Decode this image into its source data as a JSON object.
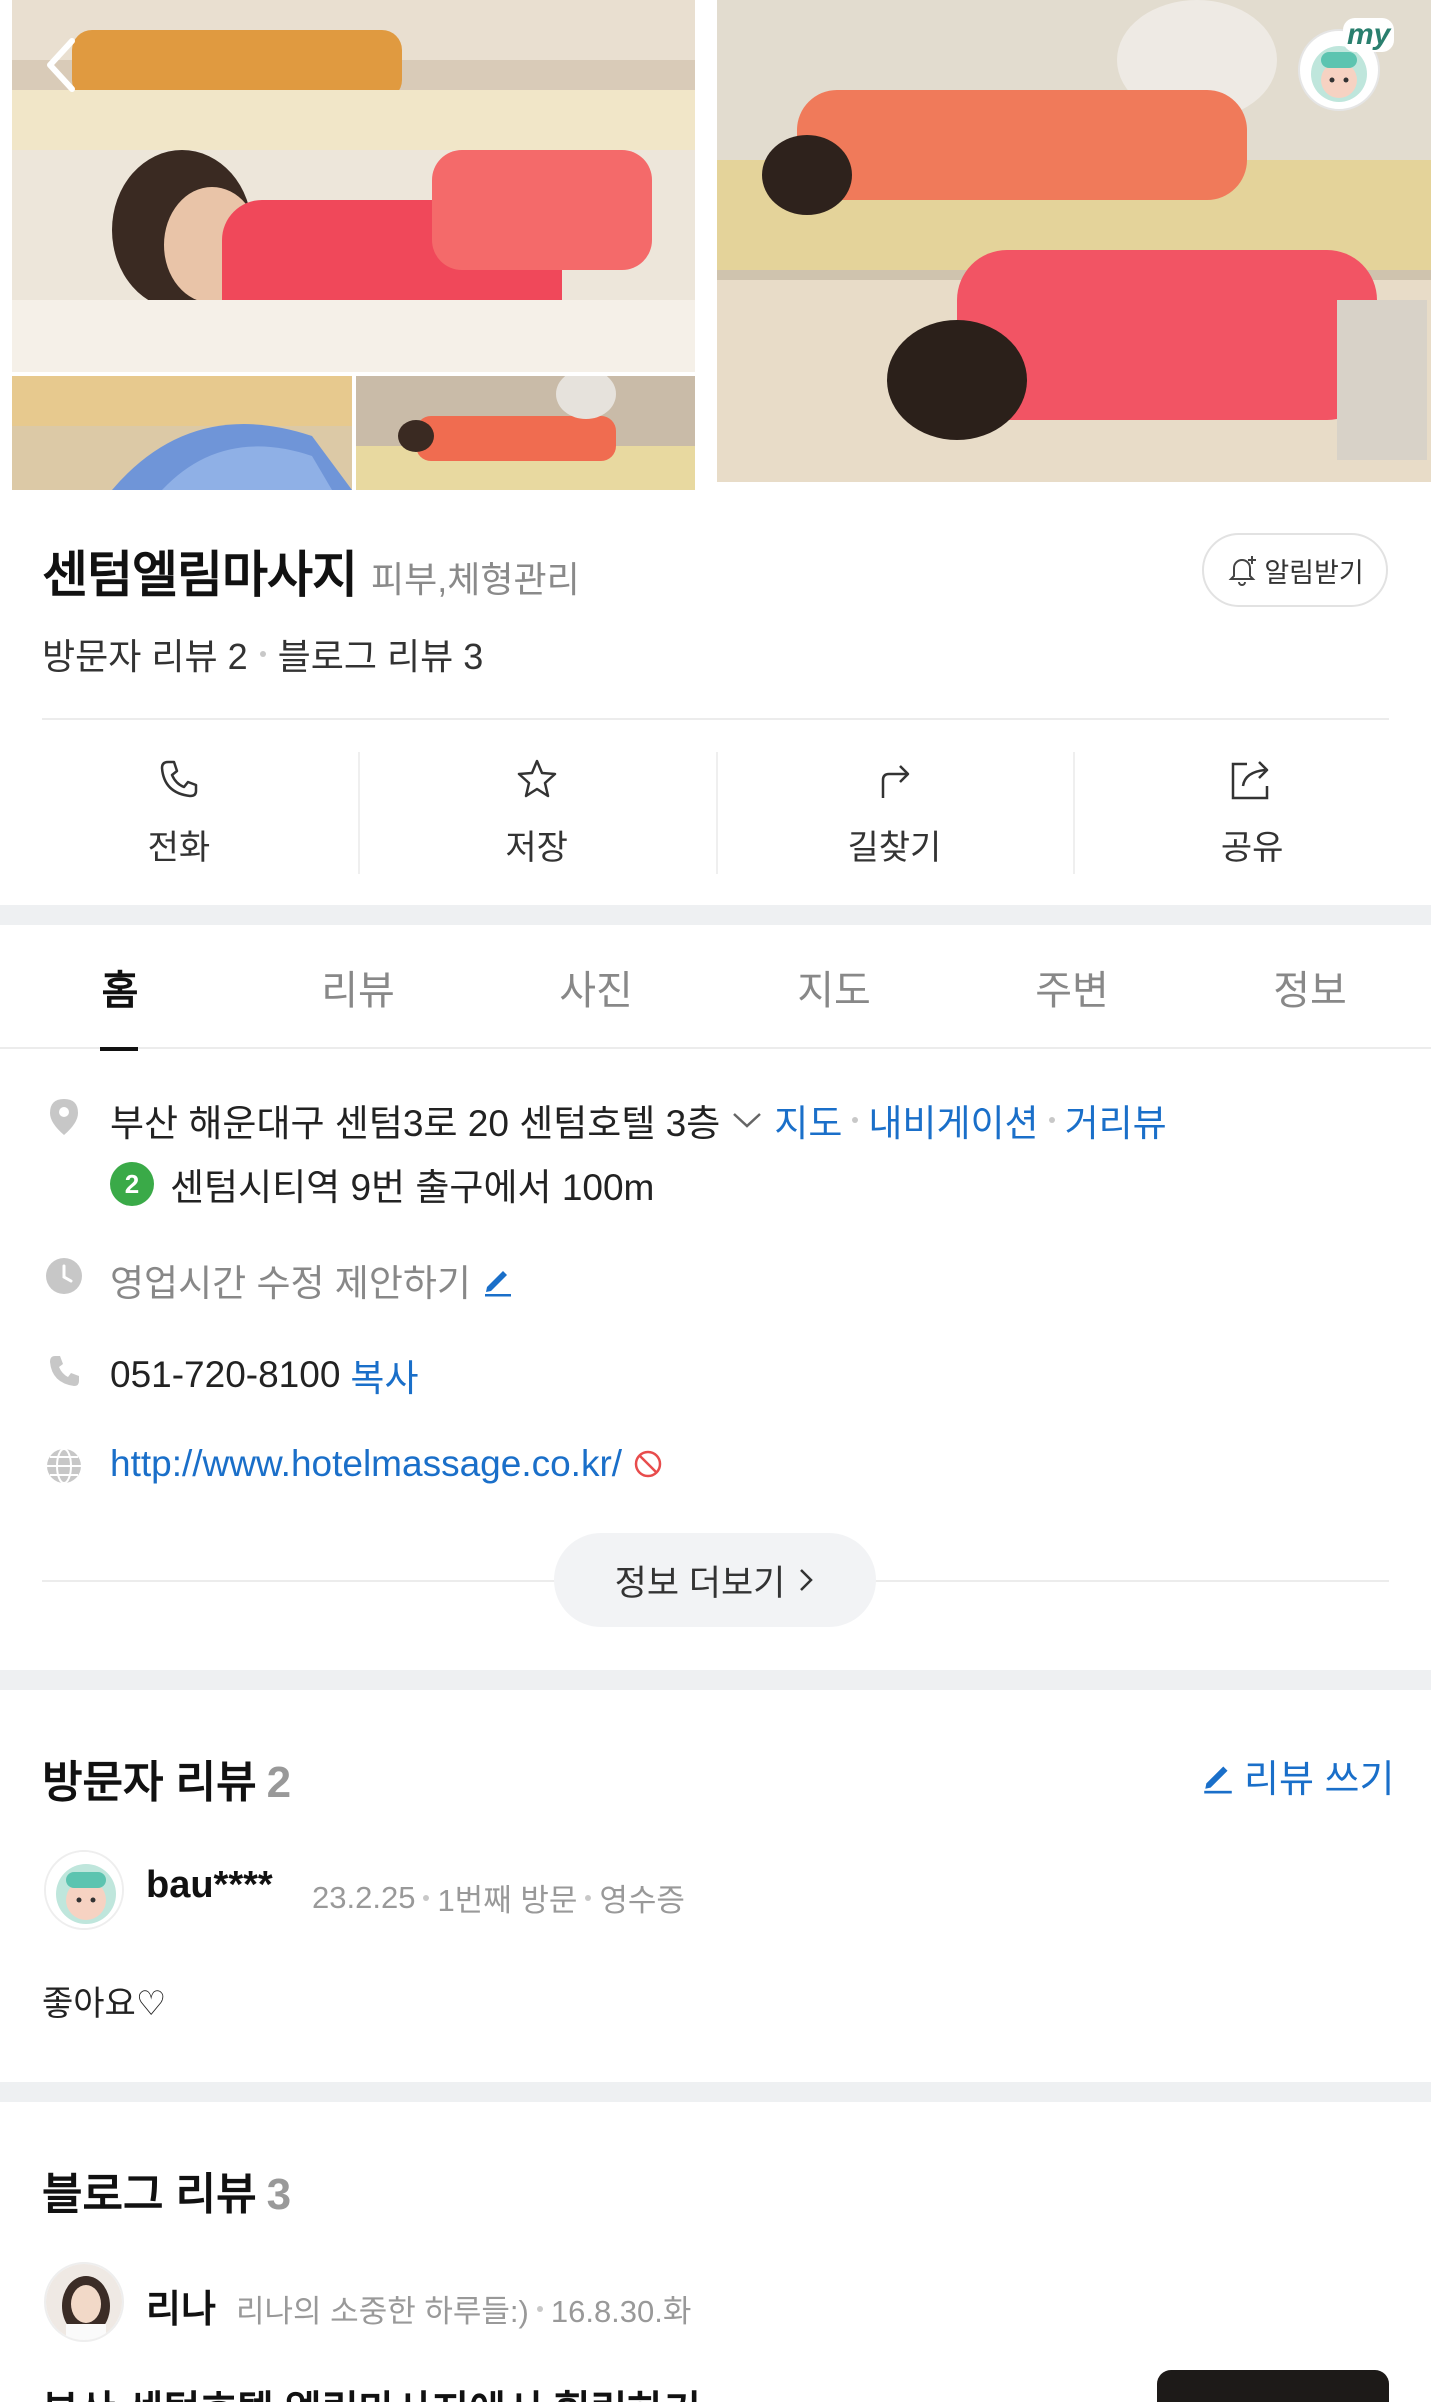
{
  "header": {
    "back_icon": "chevron-left-icon",
    "my_label": "my"
  },
  "place": {
    "name": "센텀엘림마사지",
    "category": "피부,체형관리",
    "alarm_label": "알림받기",
    "visitor_review_label": "방문자 리뷰 2",
    "blog_review_label": "블로그 리뷰 3"
  },
  "actions": [
    {
      "label": "전화",
      "icon": "phone-icon"
    },
    {
      "label": "저장",
      "icon": "star-icon"
    },
    {
      "label": "길찾기",
      "icon": "directions-icon"
    },
    {
      "label": "공유",
      "icon": "share-icon"
    }
  ],
  "tabs": [
    {
      "label": "홈",
      "active": true
    },
    {
      "label": "리뷰",
      "active": false
    },
    {
      "label": "사진",
      "active": false
    },
    {
      "label": "지도",
      "active": false
    },
    {
      "label": "주변",
      "active": false
    },
    {
      "label": "정보",
      "active": false
    }
  ],
  "info": {
    "address": "부산 해운대구 센텀3로 20 센텀호텔 3층",
    "map_link": "지도",
    "navi_link": "내비게이션",
    "street_link": "거리뷰",
    "subway_line": "2",
    "subway_text": "센텀시티역 9번 출구에서 100m",
    "hours_suggest": "영업시간 수정 제안하기",
    "phone": "051-720-8100",
    "copy_label": "복사",
    "website": "http://www.hotelmassage.co.kr/",
    "more_label": "정보 더보기"
  },
  "visitor_reviews": {
    "title": "방문자 리뷰",
    "count": "2",
    "write_label": "리뷰 쓰기",
    "items": [
      {
        "user": "bau****",
        "date": "23.2.25",
        "visit": "1번째 방문",
        "proof": "영수증",
        "text": "좋아요♡"
      }
    ]
  },
  "blog_reviews": {
    "title": "블로그 리뷰",
    "count": "3",
    "items": [
      {
        "user": "리나",
        "blog_name": "리나의 소중한 하루들:)",
        "date": "16.8.30.화",
        "title": "부산 센텀호텔 엘림마사지에서 힐링하기"
      }
    ]
  },
  "colors": {
    "link": "#1a6fc9",
    "subway_line2": "#3aaa48",
    "band": "#eef0f2"
  }
}
